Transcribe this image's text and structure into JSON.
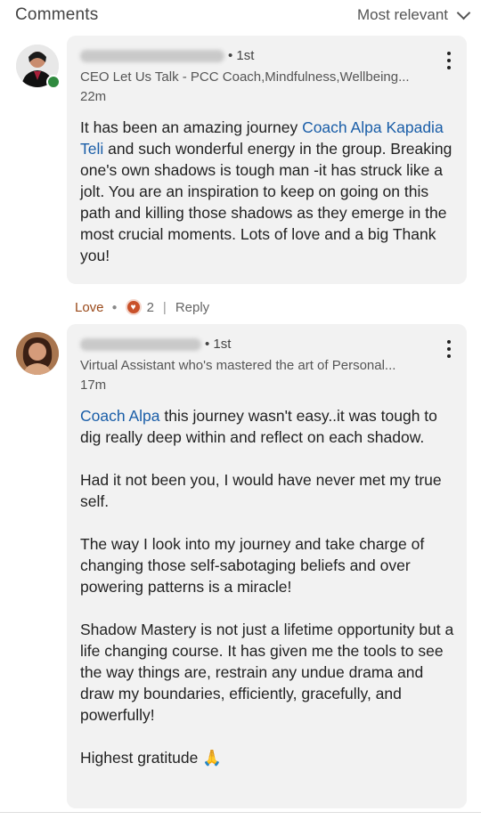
{
  "header": {
    "title": "Comments",
    "sort_label": "Most relevant"
  },
  "comments": [
    {
      "connection": "• 1st",
      "headline": "CEO Let Us Talk - PCC Coach,Mindfulness,Wellbeing...",
      "time": "22m",
      "text_lines": [
        {
          "mention": "Coach Alpa",
          "text": ""
        },
        {
          "mention": "Kapadia Teli",
          "text": " and such wonderful energy in the"
        }
      ],
      "lead": "It has been an amazing journey ",
      "rest": "group. Breaking one's own shadows is tough man -it has struck like a jolt. You are an inspiration to keep on going on this path and killing those shadows as they emerge in the most crucial moments. Lots of love and a big Thank you!"
    },
    {
      "connection": "• 1st",
      "headline": "Virtual Assistant who's mastered the art of Personal...",
      "time": "17m",
      "mention": "Coach Alpa",
      "p1_rest": " this journey wasn't easy..it was tough to dig really deep within and reflect on each shadow.",
      "p2": "Had it not been you, I would have never met my true self.",
      "p3": "The way I look into my journey and take charge of changing those self-sabotaging beliefs and over powering patterns is a miracle!",
      "p4": "Shadow Mastery is not just a lifetime opportunity but a life changing course. It has given me the tools to see the way things are, restrain any undue drama and draw my boundaries, efficiently, gracefully, and powerfully!",
      "p5": "Highest gratitude 🙏"
    }
  ],
  "actions": {
    "love": "Love",
    "reaction_count": "2",
    "reply": "Reply"
  }
}
